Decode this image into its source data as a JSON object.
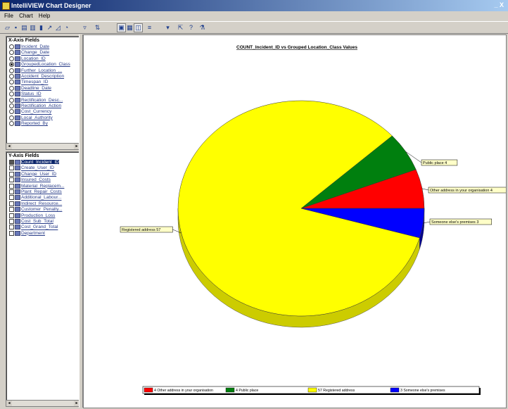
{
  "window": {
    "title": "IntelliVIEW Chart Designer",
    "controls": "_ X"
  },
  "menu": {
    "items": [
      "File",
      "Chart",
      "Help"
    ]
  },
  "toolbar": {
    "icons": [
      "open-icon",
      "save-icon",
      "print-icon",
      "bar-chart-icon",
      "column-chart-icon",
      "line-chart-icon",
      "area-chart-icon",
      "pie-chart-icon",
      "filter-icon",
      "sort-icon",
      "view-chart-icon",
      "view-table-icon",
      "view-both-icon",
      "options-icon",
      "dropdown-icon",
      "export-icon",
      "help-icon",
      "flask-icon"
    ]
  },
  "x_axis": {
    "header": "X-Axis Fields",
    "fields": [
      {
        "label": "Incident_Date",
        "selected": false
      },
      {
        "label": "Change_Date",
        "selected": false
      },
      {
        "label": "Location_ID",
        "selected": false
      },
      {
        "label": "GroupedLocation_Class",
        "selected": true
      },
      {
        "label": "Further_Location_...",
        "selected": false
      },
      {
        "label": "Accident_Description",
        "selected": false
      },
      {
        "label": "Timespan_ID",
        "selected": false
      },
      {
        "label": "Deadline_Date",
        "selected": false
      },
      {
        "label": "Status_ID",
        "selected": false
      },
      {
        "label": "Rectification_Desc...",
        "selected": false
      },
      {
        "label": "Rectification_Action",
        "selected": false
      },
      {
        "label": "Cost_Currency",
        "selected": false
      },
      {
        "label": "Local_Authority",
        "selected": false
      },
      {
        "label": "Reported_By",
        "selected": false
      }
    ]
  },
  "y_axis": {
    "header": "Y-Axis Fields",
    "fields": [
      {
        "label": "Count_Incident_ID",
        "selected": true
      },
      {
        "label": "Create_User_ID",
        "selected": false
      },
      {
        "label": "Change_User_ID",
        "selected": false
      },
      {
        "label": "Insured_Costs",
        "selected": false
      },
      {
        "label": "Material_Replacem...",
        "selected": false
      },
      {
        "label": "Plant_Repair_Costs",
        "selected": false
      },
      {
        "label": "Additional_Labour...",
        "selected": false
      },
      {
        "label": "Indirect_Resource...",
        "selected": false
      },
      {
        "label": "Customer_Penalty...",
        "selected": false
      },
      {
        "label": "Production_Loss",
        "selected": false
      },
      {
        "label": "Cost_Sub_Total",
        "selected": false
      },
      {
        "label": "Cost_Grand_Total",
        "selected": false
      },
      {
        "label": "Department",
        "selected": false
      }
    ]
  },
  "colors": {
    "yellow": "#ffff00",
    "green": "#007f0e",
    "red": "#ff0000",
    "blue": "#0000ff",
    "legend_border": "#000000"
  },
  "chart_data": {
    "type": "pie",
    "title": "COUNT_Incident_ID vs Grouped Location_Class Values",
    "categories": [
      "Other address in your organisation",
      "Public place",
      "Registered address",
      "Someone else's premises"
    ],
    "values": [
      4,
      4,
      57,
      3
    ],
    "slice_labels": [
      "Other address in your organisation 4",
      "Public place 4",
      "Registered address 57",
      "Someone else's premises 3"
    ],
    "legend_labels": [
      "4 Other address in your organisation",
      "4 Public place",
      "57 Registered address",
      "3 Someone else's premises"
    ],
    "colors": [
      "#ff0000",
      "#007f0e",
      "#ffff00",
      "#0000ff"
    ],
    "legend_position": "bottom",
    "three_d": true
  }
}
